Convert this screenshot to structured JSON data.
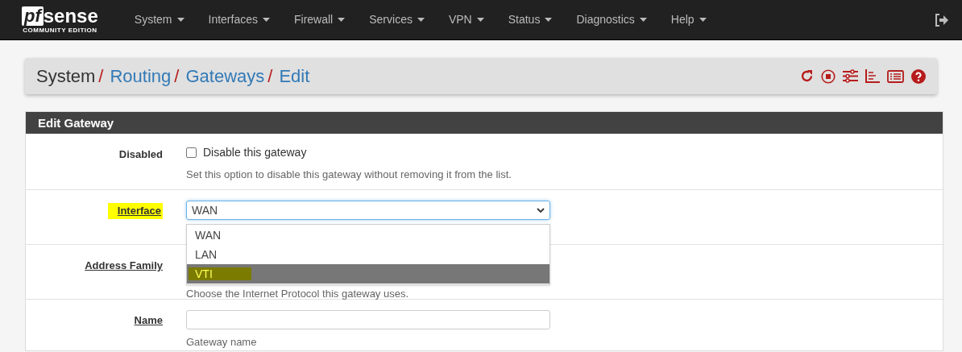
{
  "navbar": {
    "logo": {
      "prefix": "pf",
      "name": "sense",
      "edition": "COMMUNITY EDITION"
    },
    "menu": [
      {
        "label": "System"
      },
      {
        "label": "Interfaces"
      },
      {
        "label": "Firewall"
      },
      {
        "label": "Services"
      },
      {
        "label": "VPN"
      },
      {
        "label": "Status"
      },
      {
        "label": "Diagnostics"
      },
      {
        "label": "Help"
      }
    ]
  },
  "breadcrumb": [
    {
      "label": "System",
      "link": false,
      "separator": "/"
    },
    {
      "label": "Routing",
      "link": true,
      "separator": "/"
    },
    {
      "label": "Gateways",
      "link": true,
      "separator": "/"
    },
    {
      "label": "Edit",
      "link": true
    }
  ],
  "panel": {
    "title": "Edit Gateway",
    "rows": [
      {
        "kind": "checkbox",
        "label": "Disabled",
        "underlined": false,
        "highlighted": false,
        "checked": false,
        "text": "Disable this gateway",
        "help": "Set this option to disable this gateway without removing it from the list."
      },
      {
        "kind": "select",
        "label": "Interface",
        "underlined": true,
        "highlighted": true,
        "value": "WAN",
        "open": true,
        "options": [
          {
            "label": "WAN",
            "hovered": false,
            "highlighted": false
          },
          {
            "label": "LAN",
            "hovered": false,
            "highlighted": false
          },
          {
            "label": "VTI",
            "hovered": true,
            "highlighted": true
          }
        ]
      },
      {
        "kind": "covered",
        "label": "Address Family",
        "underlined": true,
        "highlighted": false,
        "help": "Choose the Internet Protocol this gateway uses."
      },
      {
        "kind": "text",
        "label": "Name",
        "underlined": true,
        "highlighted": false,
        "value": "",
        "help": "Gateway name"
      }
    ]
  }
}
